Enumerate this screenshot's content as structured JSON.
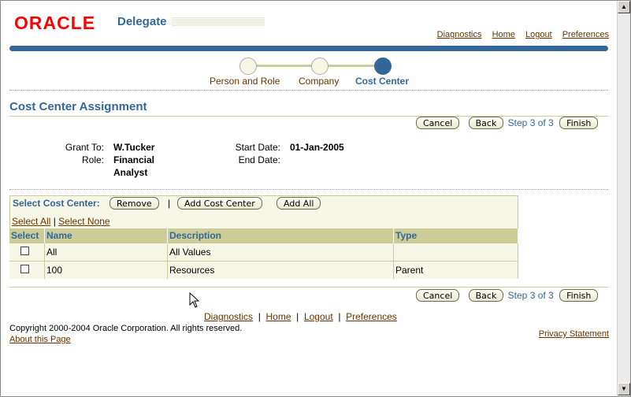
{
  "header": {
    "logo": "ORACLE",
    "app_name": "Delegate",
    "links": [
      "Diagnostics",
      "Home",
      "Logout",
      "Preferences"
    ]
  },
  "train": {
    "steps": [
      "Person and Role",
      "Company",
      "Cost Center"
    ],
    "current": "Cost Center"
  },
  "page": {
    "title": "Cost Center Assignment",
    "cancel": "Cancel",
    "back": "Back",
    "step_info": "Step 3 of 3",
    "finish": "Finish"
  },
  "details": {
    "grant_to_label": "Grant To:",
    "grant_to": "W.Tucker",
    "role_label": "Role:",
    "role_line1": "Financial",
    "role_line2": "Analyst",
    "start_date_label": "Start Date:",
    "start_date": "01-Jan-2005",
    "end_date_label": "End Date:",
    "end_date": ""
  },
  "cost_center": {
    "label": "Select Cost Center:",
    "remove": "Remove",
    "add": "Add Cost Center",
    "add_all": "Add All",
    "select_all": "Select All",
    "select_none": "Select None",
    "columns": [
      "Select",
      "Name",
      "Description",
      "Type"
    ],
    "rows": [
      {
        "name": "All",
        "description": "All Values",
        "type": ""
      },
      {
        "name": "100",
        "description": "Resources",
        "type": "Parent"
      }
    ]
  },
  "footer": {
    "links": [
      "Diagnostics",
      "Home",
      "Logout",
      "Preferences"
    ],
    "copyright": "Copyright 2000-2004 Oracle Corporation. All rights reserved.",
    "about": "About this Page",
    "privacy": "Privacy Statement"
  },
  "colors": {
    "brand_red": "#ff0000",
    "accent_blue": "#336699",
    "link_brown": "#663300",
    "table_header": "#cccc99",
    "table_bg": "#f7f7e7"
  }
}
